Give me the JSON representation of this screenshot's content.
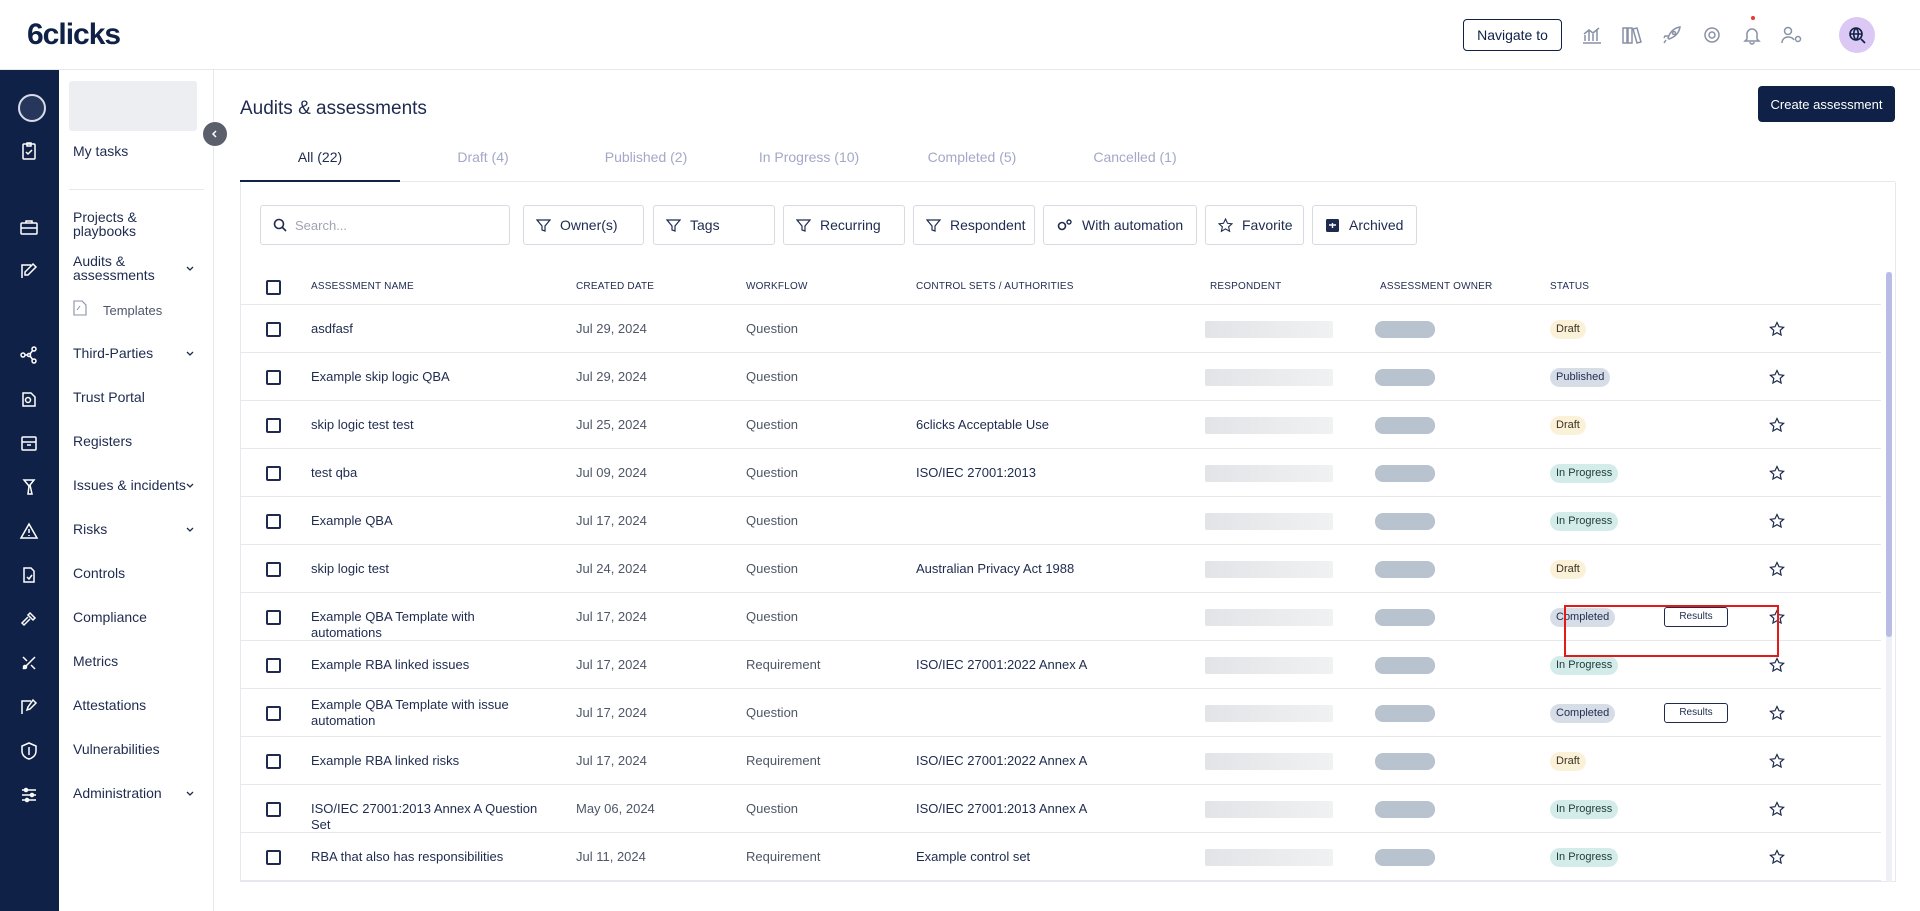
{
  "brand": {
    "logo_text": "6clicks"
  },
  "header": {
    "navigate_label": "Navigate to",
    "icons": [
      "chart-icon",
      "library-icon",
      "rocket-icon",
      "support-icon",
      "bell-icon",
      "users-settings-icon",
      "search-globe-icon"
    ]
  },
  "rail_icons": [
    "avatar",
    "clipboard-icon",
    "briefcase-icon",
    "edit-icon",
    "network-icon",
    "trust-icon",
    "register-icon",
    "issue-icon",
    "warning-icon",
    "controls-icon",
    "hammer-icon",
    "metrics-icon",
    "attest-icon",
    "shield-icon",
    "settings-sliders-icon"
  ],
  "sidebar": {
    "my_tasks": "My tasks",
    "projects": "Projects & playbooks",
    "audits": "Audits & assessments",
    "templates": "Templates",
    "third_parties": "Third-Parties",
    "trust_portal": "Trust Portal",
    "registers": "Registers",
    "issues": "Issues & incidents",
    "risks": "Risks",
    "controls": "Controls",
    "compliance": "Compliance",
    "metrics": "Metrics",
    "attestations": "Attestations",
    "vulnerabilities": "Vulnerabilities",
    "administration": "Administration"
  },
  "page": {
    "title": "Audits & assessments",
    "create_label": "Create assessment"
  },
  "tabs": [
    "All (22)",
    "Draft (4)",
    "Published (2)",
    "In Progress (10)",
    "Completed (5)",
    "Cancelled (1)"
  ],
  "filters": {
    "search_placeholder": "Search...",
    "owner": "Owner(s)",
    "tags": "Tags",
    "recurring": "Recurring",
    "respondent": "Respondent",
    "automation": "With automation",
    "favorite": "Favorite",
    "archived": "Archived"
  },
  "columns": {
    "name": "ASSESSMENT NAME",
    "created": "CREATED DATE",
    "workflow": "WORKFLOW",
    "controls": "CONTROL SETS / AUTHORITIES",
    "respondent": "RESPONDENT",
    "owner": "ASSESSMENT OWNER",
    "status": "STATUS"
  },
  "results_label": "Results",
  "rows": [
    {
      "name": "asdfasf",
      "date": "Jul 29, 2024",
      "workflow": "Question",
      "controls": "",
      "status": "Draft"
    },
    {
      "name": "Example skip logic QBA",
      "date": "Jul 29, 2024",
      "workflow": "Question",
      "controls": "",
      "status": "Published"
    },
    {
      "name": "skip logic test test",
      "date": "Jul 25, 2024",
      "workflow": "Question",
      "controls": "6clicks Acceptable Use",
      "status": "Draft"
    },
    {
      "name": "test qba",
      "date": "Jul 09, 2024",
      "workflow": "Question",
      "controls": "ISO/IEC 27001:2013",
      "status": "In Progress"
    },
    {
      "name": "Example QBA",
      "date": "Jul 17, 2024",
      "workflow": "Question",
      "controls": "",
      "status": "In Progress"
    },
    {
      "name": "skip logic test",
      "date": "Jul 24, 2024",
      "workflow": "Question",
      "controls": "Australian Privacy Act 1988",
      "status": "Draft"
    },
    {
      "name": "Example QBA Template with automations",
      "date": "Jul 17, 2024",
      "workflow": "Question",
      "controls": "",
      "status": "Completed"
    },
    {
      "name": "Example RBA linked issues",
      "date": "Jul 17, 2024",
      "workflow": "Requirement",
      "controls": "ISO/IEC 27001:2022 Annex A",
      "status": "In Progress"
    },
    {
      "name": "Example QBA Template with issue automation",
      "date": "Jul 17, 2024",
      "workflow": "Question",
      "controls": "",
      "status": "Completed"
    },
    {
      "name": "Example RBA linked risks",
      "date": "Jul 17, 2024",
      "workflow": "Requirement",
      "controls": "ISO/IEC 27001:2022 Annex A",
      "status": "Draft"
    },
    {
      "name": "ISO/IEC 27001:2013 Annex A Question Set",
      "date": "May 06, 2024",
      "workflow": "Question",
      "controls": "ISO/IEC 27001:2013 Annex A",
      "status": "In Progress"
    },
    {
      "name": "RBA that also has responsibilities",
      "date": "Jul 11, 2024",
      "workflow": "Requirement",
      "controls": "Example control set",
      "status": "In Progress"
    }
  ],
  "colors": {
    "navy": "#0f2147",
    "accent_highlight": "#e11a1a"
  }
}
